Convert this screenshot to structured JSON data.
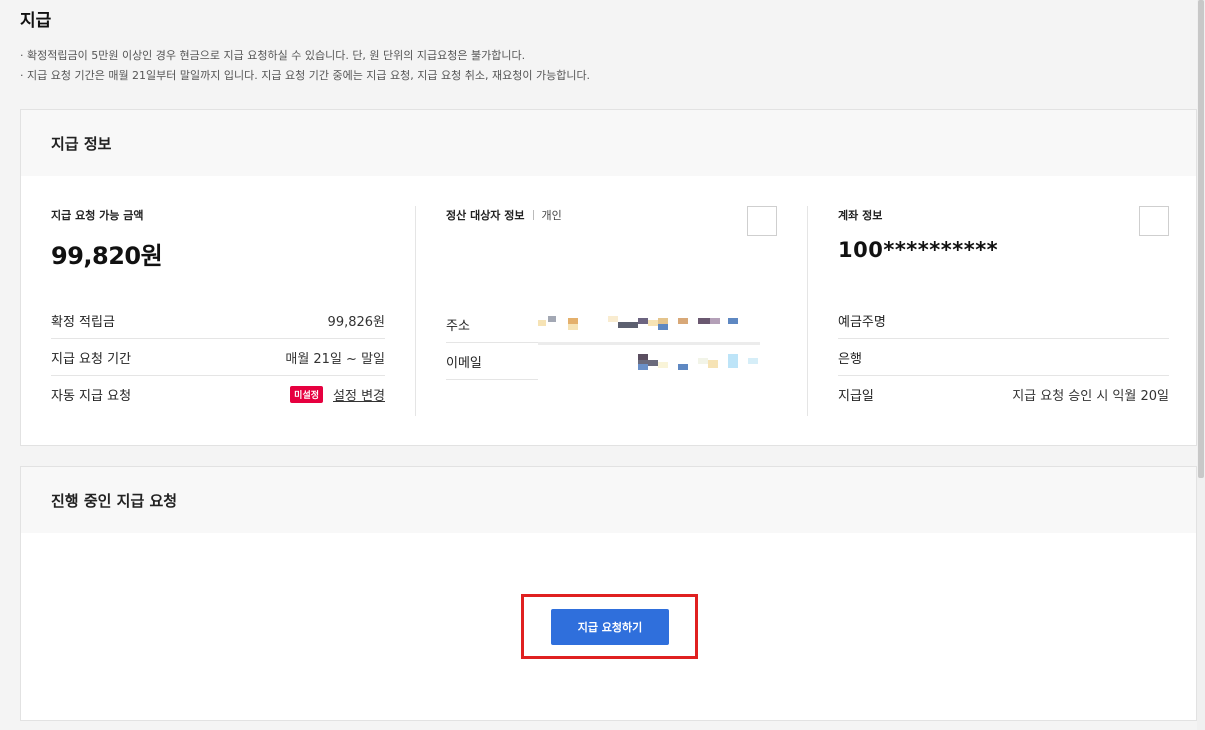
{
  "page": {
    "title": "지급",
    "notices": [
      "· 확정적립금이 5만원 이상인 경우 현금으로 지급 요청하실 수 있습니다. 단, 원 단위의 지급요청은 불가합니다.",
      "· 지급 요청 기간은 매월 21일부터 말일까지 입니다. 지급 요청 기간 중에는 지급 요청, 지급 요청 취소, 재요청이 가능합니다."
    ]
  },
  "payment_info": {
    "heading": "지급 정보",
    "available": {
      "label": "지급 요청 가능 금액",
      "amount": "99,820원",
      "rows": {
        "confirmed_label": "확정 적립금",
        "confirmed_value": "99,826원",
        "period_label": "지급 요청 기간",
        "period_value": "매월 21일 ~ 말일",
        "auto_label": "자동 지급 요청",
        "auto_badge": "미설정",
        "auto_link": "설정 변경"
      }
    },
    "settlement": {
      "label": "정산 대상자 정보",
      "type": "개인",
      "address_label": "주소",
      "email_label": "이메일"
    },
    "account": {
      "label": "계좌 정보",
      "number": "100**********",
      "holder_label": "예금주명",
      "bank_label": "은행",
      "payday_label": "지급일",
      "payday_value": "지급 요청 승인 시 익월 20일"
    }
  },
  "progress": {
    "heading": "진행 중인 지급 요청",
    "button_label": "지급 요청하기"
  },
  "colors": {
    "primary_button": "#2f6fdc",
    "badge": "#e6003f",
    "highlight_frame": "#e02020"
  }
}
